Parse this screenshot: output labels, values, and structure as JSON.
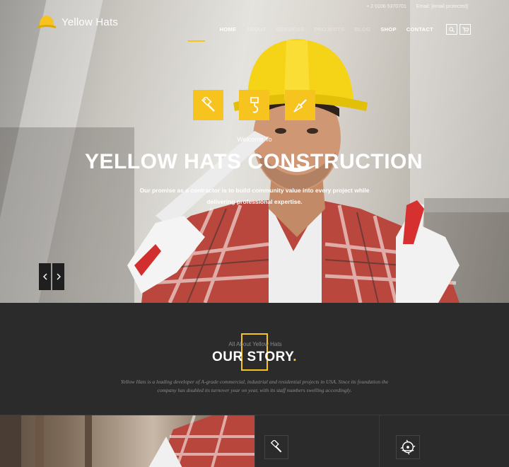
{
  "topbar": {
    "phone": "+ 2 0106 5370701",
    "email": "Email: [email protected]"
  },
  "brand": {
    "name": "Yellow Hats"
  },
  "nav": {
    "items": [
      "HOME",
      "ABOUT",
      "SERVICES",
      "PROJECTS",
      "BLOG",
      "SHOP",
      "CONTACT"
    ],
    "active": "HOME"
  },
  "hero": {
    "welcome": "Welcome To",
    "title": "YELLOW HATS CONSTRUCTION",
    "subtitle": "Our promise as a contractor is to build community value into every project while delivering professional expertise."
  },
  "story": {
    "eyebrow": "All About Yellow Hats",
    "title": "OUR STORY",
    "title_dot": ".",
    "text": "Yellow Hats is a leading developer of A-grade commercial, industrial and residential projects in USA. Since its foundation the company has doubled its turnover year on year, with its staff numbers swelling accordingly."
  },
  "icons": {
    "features": [
      "paint-brush-icon",
      "crane-hook-icon",
      "trowel-icon"
    ],
    "panels": [
      "paint-brush-icon",
      "saw-blade-icon"
    ]
  },
  "colors": {
    "accent": "#f7c31f",
    "dark": "#2b2b2b",
    "white": "#ffffff"
  }
}
